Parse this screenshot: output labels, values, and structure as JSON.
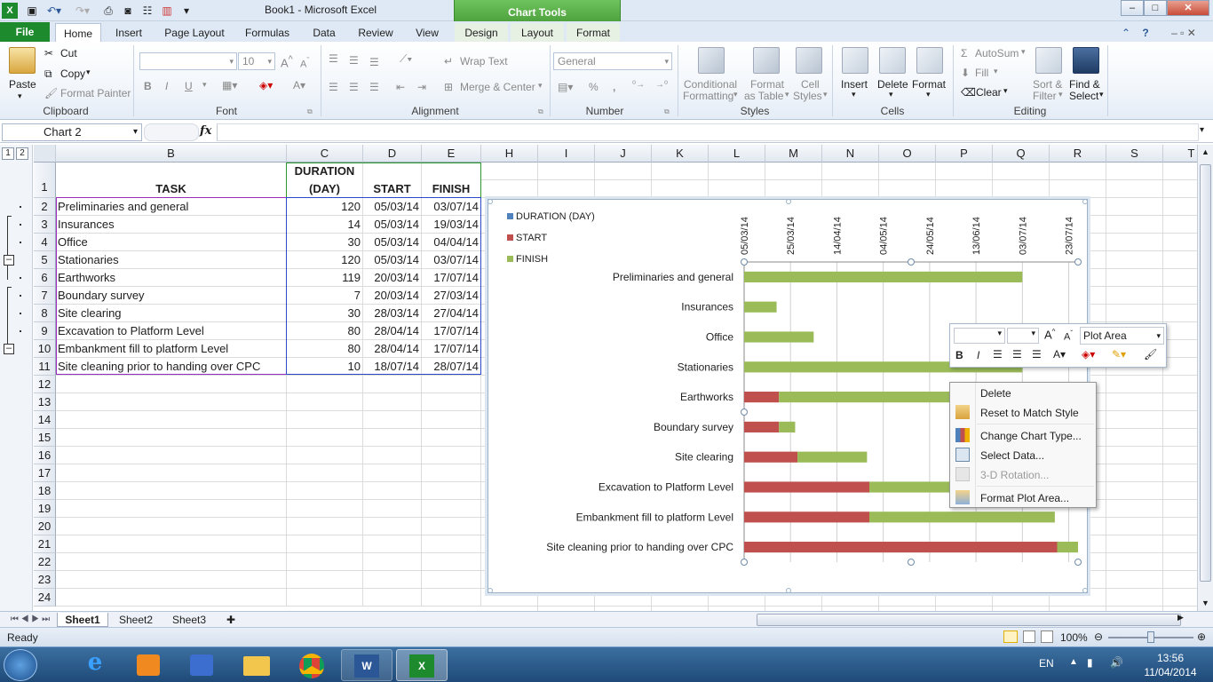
{
  "window": {
    "title": "Book1  -  Microsoft Excel",
    "contextual_tab_group": "Chart Tools",
    "controls": [
      "–",
      "□",
      "✕"
    ]
  },
  "tabs": [
    "File",
    "Home",
    "Insert",
    "Page Layout",
    "Formulas",
    "Data",
    "Review",
    "View",
    "Design",
    "Layout",
    "Format"
  ],
  "ribbon": {
    "clipboard": {
      "paste": "Paste",
      "cut": "Cut",
      "copy": "Copy",
      "format_painter": "Format Painter",
      "label": "Clipboard"
    },
    "font": {
      "font_size": "10",
      "label": "Font"
    },
    "alignment": {
      "wrap_text": "Wrap Text",
      "merge_center": "Merge & Center",
      "label": "Alignment"
    },
    "number": {
      "format": "General",
      "label": "Number"
    },
    "styles": {
      "conditional": "Conditional",
      "formatting": "Formatting",
      "format": "Format",
      "as_table": "as Table",
      "cell": "Cell",
      "styles_word": "Styles",
      "label": "Styles"
    },
    "cells": {
      "insert": "Insert",
      "delete": "Delete",
      "format": "Format",
      "label": "Cells"
    },
    "editing": {
      "autosum": "AutoSum",
      "fill": "Fill",
      "clear": "Clear",
      "sort": "Sort &",
      "filter": "Filter",
      "find": "Find &",
      "select": "Select",
      "label": "Editing"
    }
  },
  "formula_bar": {
    "name_box": "Chart 2",
    "fx": "fx"
  },
  "columns": [
    "B",
    "C",
    "D",
    "E",
    "H",
    "I",
    "J",
    "K",
    "L",
    "M",
    "N",
    "O",
    "P",
    "Q",
    "R",
    "S",
    "T"
  ],
  "outline_levels": [
    "1",
    "2"
  ],
  "headers": {
    "task": "TASK",
    "duration_1": "DURATION",
    "duration_2": "(DAY)",
    "start": "START",
    "finish": "FINISH"
  },
  "rows": [
    {
      "n": "2",
      "task": "Preliminaries and general",
      "dur": "120",
      "start": "05/03/14",
      "finish": "03/07/14"
    },
    {
      "n": "3",
      "task": "Insurances",
      "dur": "14",
      "start": "05/03/14",
      "finish": "19/03/14"
    },
    {
      "n": "4",
      "task": "Office",
      "dur": "30",
      "start": "05/03/14",
      "finish": "04/04/14"
    },
    {
      "n": "5",
      "task": "Stationaries",
      "dur": "120",
      "start": "05/03/14",
      "finish": "03/07/14"
    },
    {
      "n": "6",
      "task": "Earthworks",
      "dur": "119",
      "start": "20/03/14",
      "finish": "17/07/14"
    },
    {
      "n": "7",
      "task": "Boundary survey",
      "dur": "7",
      "start": "20/03/14",
      "finish": "27/03/14"
    },
    {
      "n": "8",
      "task": "Site clearing",
      "dur": "30",
      "start": "28/03/14",
      "finish": "27/04/14"
    },
    {
      "n": "9",
      "task": "Excavation to Platform Level",
      "dur": "80",
      "start": "28/04/14",
      "finish": "17/07/14"
    },
    {
      "n": "10",
      "task": "Embankment fill to platform Level",
      "dur": "80",
      "start": "28/04/14",
      "finish": "17/07/14"
    },
    {
      "n": "11",
      "task": "Site cleaning prior to handing over CPC",
      "dur": "10",
      "start": "18/07/14",
      "finish": "28/07/14"
    }
  ],
  "empty_rows": [
    "12",
    "13",
    "14",
    "15",
    "16",
    "17",
    "18",
    "19",
    "20",
    "21",
    "22",
    "23",
    "24"
  ],
  "chart_data": {
    "type": "bar",
    "orientation": "horizontal-stacked",
    "categories": [
      "Preliminaries and general",
      "Insurances",
      "Office",
      "Stationaries",
      "Earthworks",
      "Boundary survey",
      "Site clearing",
      "Excavation to Platform Level",
      "Embankment fill to platform Level",
      "Site cleaning prior to handing over CPC"
    ],
    "series": [
      {
        "name": "DURATION (DAY)",
        "color": "#4f81bd",
        "values": [
          120,
          14,
          30,
          120,
          119,
          7,
          30,
          80,
          80,
          10
        ]
      },
      {
        "name": "START",
        "color": "#c0504d",
        "values": [
          "2014-03-05",
          "2014-03-05",
          "2014-03-05",
          "2014-03-05",
          "2014-03-20",
          "2014-03-20",
          "2014-03-28",
          "2014-04-28",
          "2014-04-28",
          "2014-07-18"
        ]
      },
      {
        "name": "FINISH",
        "color": "#9bbb59",
        "values": [
          "2014-07-03",
          "2014-03-19",
          "2014-04-04",
          "2014-07-03",
          "2014-07-17",
          "2014-03-27",
          "2014-04-27",
          "2014-07-17",
          "2014-07-17",
          "2014-07-28"
        ]
      }
    ],
    "x_axis_ticks": [
      "05/03/14",
      "25/03/14",
      "14/04/14",
      "04/05/14",
      "24/05/14",
      "13/06/14",
      "03/07/14",
      "23/07/14"
    ],
    "x_axis_position": "top",
    "xlim": [
      "2014-03-05",
      "2014-07-27"
    ],
    "legend_position": "top-left",
    "grid": true
  },
  "mini_toolbar": {
    "element_select": "Plot Area"
  },
  "context_menu": [
    {
      "label": "Delete",
      "enabled": true
    },
    {
      "label": "Reset to Match Style",
      "enabled": true
    },
    {
      "label": "Change Chart Type...",
      "enabled": true
    },
    {
      "label": "Select Data...",
      "enabled": true
    },
    {
      "label": "3-D Rotation...",
      "enabled": false
    },
    {
      "label": "Format Plot Area...",
      "enabled": true
    }
  ],
  "sheets": [
    "Sheet1",
    "Sheet2",
    "Sheet3"
  ],
  "status": {
    "ready": "Ready",
    "zoom": "100%"
  },
  "taskbar": {
    "lang": "EN",
    "time": "13:56",
    "date": "11/04/2014"
  }
}
